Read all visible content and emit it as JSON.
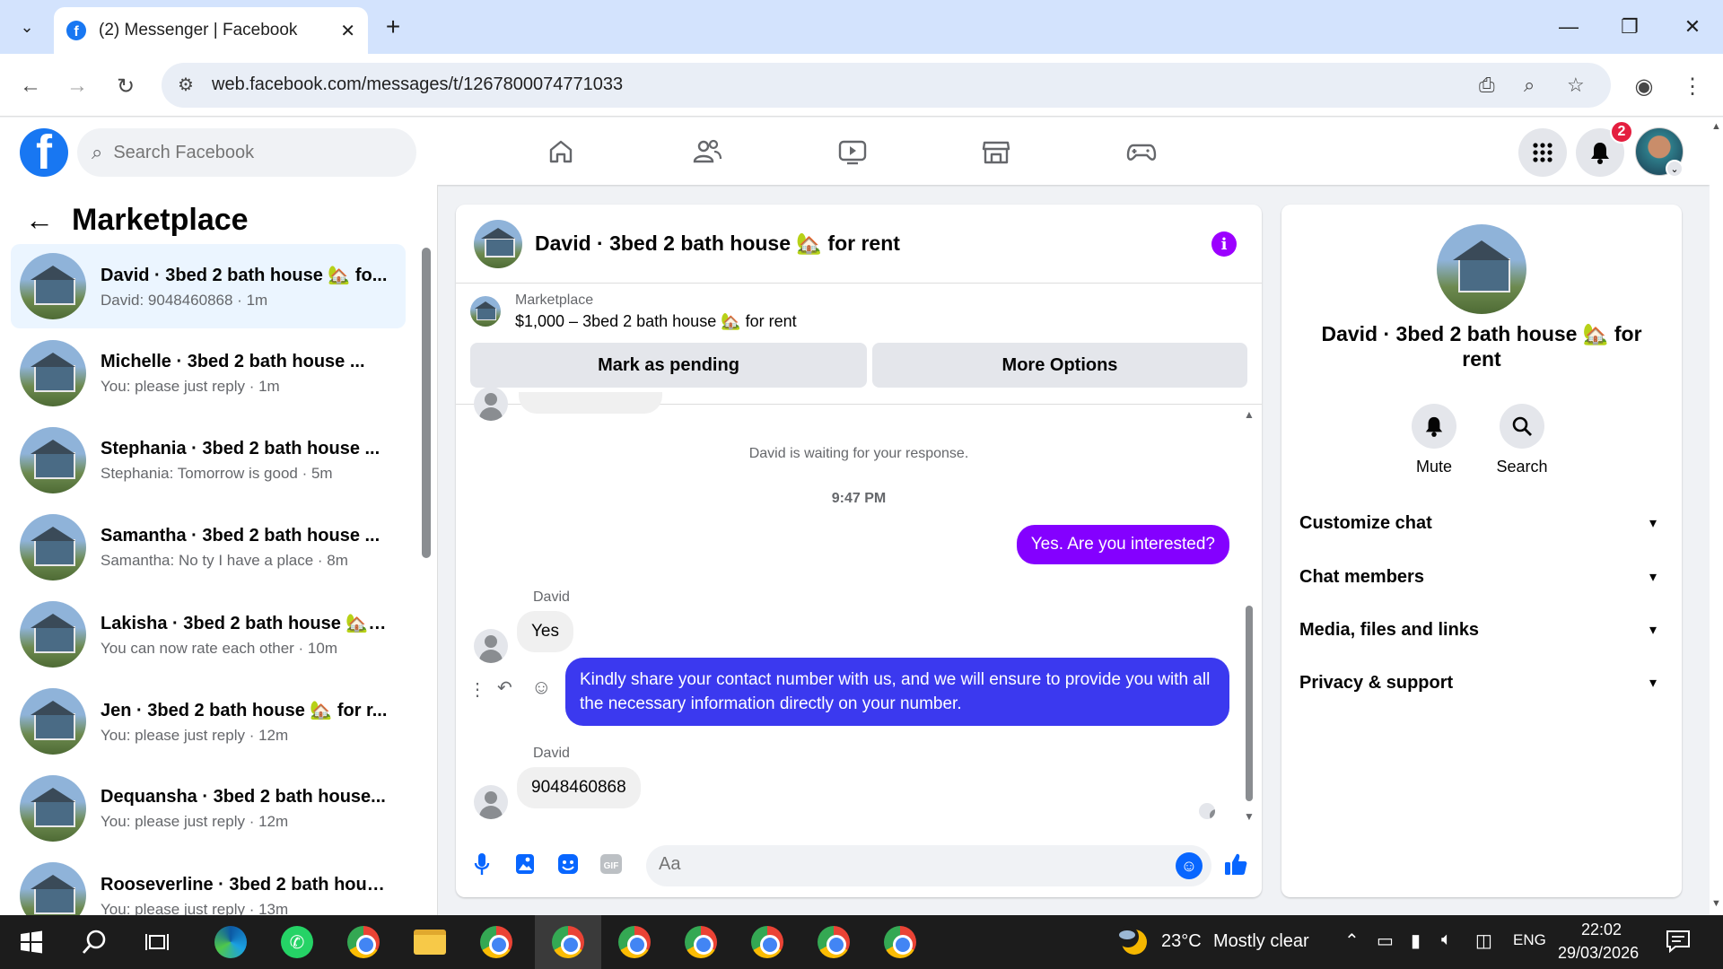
{
  "browser": {
    "tab_title": "(2) Messenger | Facebook",
    "url": "web.facebook.com/messages/t/1267800074771033",
    "new_tab": "+",
    "close_tab": "✕"
  },
  "facebook": {
    "search_placeholder": "Search Facebook",
    "notification_count": "2"
  },
  "left": {
    "title": "Marketplace",
    "conversations": [
      {
        "name": "David · 3bed 2 bath house 🏡 fo...",
        "preview": "David: 9048460868 · 1m",
        "active": true
      },
      {
        "name": "Michelle · 3bed 2 bath house ...",
        "preview": "You: please just reply · 1m"
      },
      {
        "name": "Stephania · 3bed 2 bath house ...",
        "preview": "Stephania: Tomorrow is good · 5m"
      },
      {
        "name": "Samantha · 3bed 2 bath house ...",
        "preview": "Samantha: No ty I have a place · 8m"
      },
      {
        "name": "Lakisha · 3bed 2 bath house 🏡 ...",
        "preview": "You can now rate each other · 10m"
      },
      {
        "name": "Jen · 3bed 2 bath house 🏡 for r...",
        "preview": "You: please just reply · 12m"
      },
      {
        "name": "Dequansha · 3bed 2 bath house...",
        "preview": "You: please just reply · 12m"
      },
      {
        "name": "Rooseverline · 3bed 2 bath hous...",
        "preview": "You: please just reply · 13m"
      }
    ]
  },
  "chat": {
    "title": "David · 3bed 2 bath house 🏡 for rent",
    "marketplace_label": "Marketplace",
    "listing": "$1,000 – 3bed 2 bath house 🏡 for rent",
    "mark_pending": "Mark as pending",
    "more_options": "More Options",
    "waiting": "David is waiting for your response.",
    "time": "9:47 PM",
    "messages": [
      {
        "from": "me",
        "text": "Yes. Are you interested?"
      },
      {
        "from": "David",
        "sender": "David",
        "text": "Yes"
      },
      {
        "from": "me",
        "text": "Kindly share your contact number with us, and we will ensure to provide you with all the necessary information directly on your number."
      },
      {
        "from": "David",
        "sender": "David",
        "text": "9048460868"
      }
    ],
    "composer_placeholder": "Aa"
  },
  "details": {
    "name": "David · 3bed 2 bath house 🏡 for rent",
    "mute_label": "Mute",
    "search_label": "Search",
    "sections": [
      "Customize chat",
      "Chat members",
      "Media, files and links",
      "Privacy & support"
    ]
  },
  "taskbar": {
    "weather_temp": "23°C",
    "weather_desc": "Mostly clear",
    "language": "ENG",
    "time": "22:02",
    "date": "29/03/2026"
  }
}
